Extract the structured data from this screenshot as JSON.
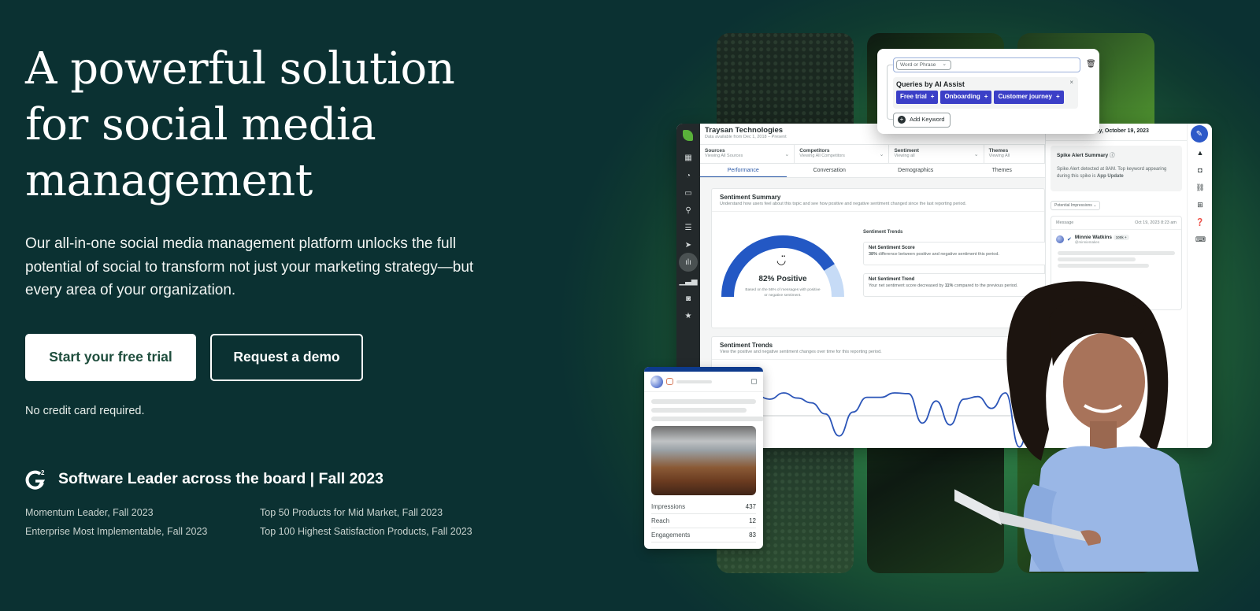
{
  "hero": {
    "headline_lines": [
      "A powerful solution",
      "for social media",
      "management"
    ],
    "subtext": "Our all-in-one social media management platform unlocks the full potential of social to transform not just your marketing strategy—but every area of your organization.",
    "cta_primary": "Start your free trial",
    "cta_secondary": "Request a demo",
    "note": "No credit card required."
  },
  "awards": {
    "logo": "g2-logo-icon",
    "title": "Software Leader across the board | Fall 2023",
    "items": [
      "Momentum Leader, Fall 2023",
      "Top 50 Products for Mid Market, Fall 2023",
      "Enterprise Most Implementable, Fall 2023",
      "Top 100 Highest Satisfaction Products, Fall 2023"
    ]
  },
  "keyword_popup": {
    "match_type": "Word or Phrase",
    "ai_title": "Queries by AI Assist",
    "chips": [
      "Free trial",
      "Onboarding",
      "Customer journey"
    ],
    "add_label": "Add Keyword"
  },
  "dashboard": {
    "company": "Traysan Technologies",
    "data_range": "Data available from Dec 1, 2018 – Present",
    "filters": [
      {
        "label": "Sources",
        "value": "Viewing All Sources"
      },
      {
        "label": "Competitors",
        "value": "Viewing All Competitors"
      },
      {
        "label": "Sentiment",
        "value": "Viewing all"
      },
      {
        "label": "Themes",
        "value": "Viewing All"
      }
    ],
    "tabs": [
      "Performance",
      "Conversation",
      "Demographics",
      "Themes"
    ],
    "active_tab": "Performance",
    "sentiment_summary": {
      "title": "Sentiment Summary",
      "subtitle": "Understand how users feel about this topic and see how positive and negative sentiment changed since the last reporting period.",
      "positive_percent": 82,
      "gauge_label": "82% Positive",
      "gauge_note": "Based on the 56% of messages with positive or negative sentiment.",
      "trends_heading": "Sentiment Trends",
      "net_score_title": "Net Sentiment Score",
      "net_score_value": "38%",
      "net_score_desc": " difference between positive and negative sentiment this period.",
      "net_trend_title": "Net Sentiment Trend",
      "net_trend_prefix": "Your net sentiment score decreased by ",
      "net_trend_value": "11%",
      "net_trend_suffix": " compared to the previous period."
    },
    "sentiment_trends": {
      "title": "Sentiment Trends",
      "subtitle": "View the positive and negative sentiment changes over time for this reporting period.",
      "values": [
        0.55,
        0.45,
        0.62,
        0.48,
        0.35,
        0.05,
        -0.55,
        0.1,
        0.5,
        0.5,
        0.62,
        0.6,
        -0.2,
        0.4,
        -0.25,
        0.45,
        0.52,
        0.2,
        0.62,
        -0.85,
        0.3
      ]
    },
    "side_panel": {
      "date": "Thursday, October 19, 2023",
      "spike_title": "Spike Alert Summary",
      "spike_text": "Spike Alert detected at 8AM. Top keyword appearing during this spike is ",
      "spike_keyword": "App Update",
      "metric_select": "Potential Impressions",
      "message_col": "Message",
      "message_time": "Oct 19, 2023 8:23 am",
      "author": "Minnie Watkins",
      "author_handle": "@minniemakes",
      "author_badge": "100k +"
    }
  },
  "post_card": {
    "stats": [
      {
        "label": "Impressions",
        "value": "437"
      },
      {
        "label": "Reach",
        "value": "12"
      },
      {
        "label": "Engagements",
        "value": "83"
      }
    ]
  },
  "colors": {
    "background": "#0b3132",
    "glow": "#3f9a52",
    "accent_blue": "#2d59c8",
    "chip": "#3b3fc7",
    "cta_text": "#1e4d3c"
  }
}
